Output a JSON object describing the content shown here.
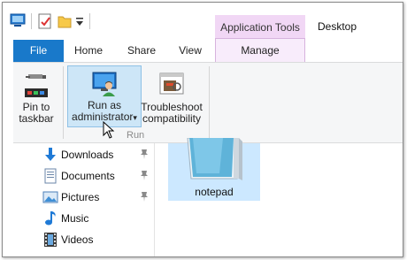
{
  "titlebar": {
    "context_tab": "Application Tools",
    "window_title": "Desktop"
  },
  "tabs": [
    "File",
    "Home",
    "Share",
    "View",
    "Manage"
  ],
  "ribbon": {
    "pin": {
      "line1": "Pin to",
      "line2": "taskbar"
    },
    "run_as": {
      "line1": "Run as",
      "line2": "administrator",
      "arrow": "▾"
    },
    "troubleshoot": {
      "line1": "Troubleshoot",
      "line2": "compatibility"
    },
    "group_label": "Run"
  },
  "nav": {
    "items": [
      {
        "label": "Downloads",
        "icon": "downloads-icon",
        "pinned": true
      },
      {
        "label": "Documents",
        "icon": "documents-icon",
        "pinned": true
      },
      {
        "label": "Pictures",
        "icon": "pictures-icon",
        "pinned": true
      },
      {
        "label": "Music",
        "icon": "music-icon",
        "pinned": false
      },
      {
        "label": "Videos",
        "icon": "videos-icon",
        "pinned": false
      }
    ]
  },
  "files": [
    {
      "name": "notepad",
      "selected": true
    }
  ],
  "colors": {
    "file_tab": "#1979ca",
    "context_tab": "#f1d7f5",
    "selected_button": "#cde6f7",
    "selected_file": "#cce8ff"
  }
}
